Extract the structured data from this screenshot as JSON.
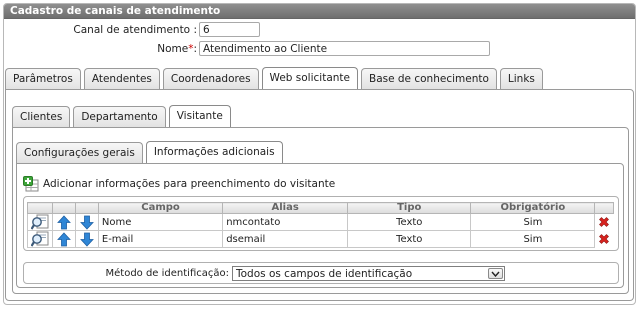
{
  "panel": {
    "title": "Cadastro de canais de atendimento"
  },
  "form": {
    "canal_label": "Canal de atendimento :",
    "canal_value": "6",
    "nome_label": "Nome",
    "nome_required": "*",
    "nome_colon": ":",
    "nome_value": "Atendimento ao Cliente"
  },
  "main_tabs": [
    {
      "label": "Parâmetros"
    },
    {
      "label": "Atendentes"
    },
    {
      "label": "Coordenadores"
    },
    {
      "label": "Web solicitante",
      "active": true
    },
    {
      "label": "Base de conhecimento"
    },
    {
      "label": "Links"
    }
  ],
  "sub_tabs": [
    {
      "label": "Clientes"
    },
    {
      "label": "Departamento"
    },
    {
      "label": "Visitante",
      "active": true
    }
  ],
  "inner_tabs": [
    {
      "label": "Configurações gerais"
    },
    {
      "label": "Informações adicionais",
      "active": true
    }
  ],
  "add_action": {
    "label": "Adicionar informações para preenchimento do visitante"
  },
  "grid": {
    "columns": [
      "Campo",
      "Alias",
      "Tipo",
      "Obrigatório"
    ],
    "rows": [
      {
        "campo": "Nome",
        "alias": "nmcontato",
        "tipo": "Texto",
        "obrigatorio": "Sim"
      },
      {
        "campo": "E-mail",
        "alias": "dsemail",
        "tipo": "Texto",
        "obrigatorio": "Sim"
      }
    ]
  },
  "identification": {
    "label": "Método de identificação:",
    "selected": "Todos os campos de identificação"
  },
  "icons": {
    "edit": "magnifier-edit-icon",
    "up": "arrow-up-icon",
    "down": "arrow-down-icon",
    "delete": "red-x-delete-icon",
    "add": "green-plus-table-icon",
    "select": "chevron-down-icon"
  },
  "colors": {
    "title_bar": "#7f7f7f",
    "arrow_blue": "#2f86d6",
    "delete_red": "#d9231f",
    "required": "#cc0000"
  }
}
